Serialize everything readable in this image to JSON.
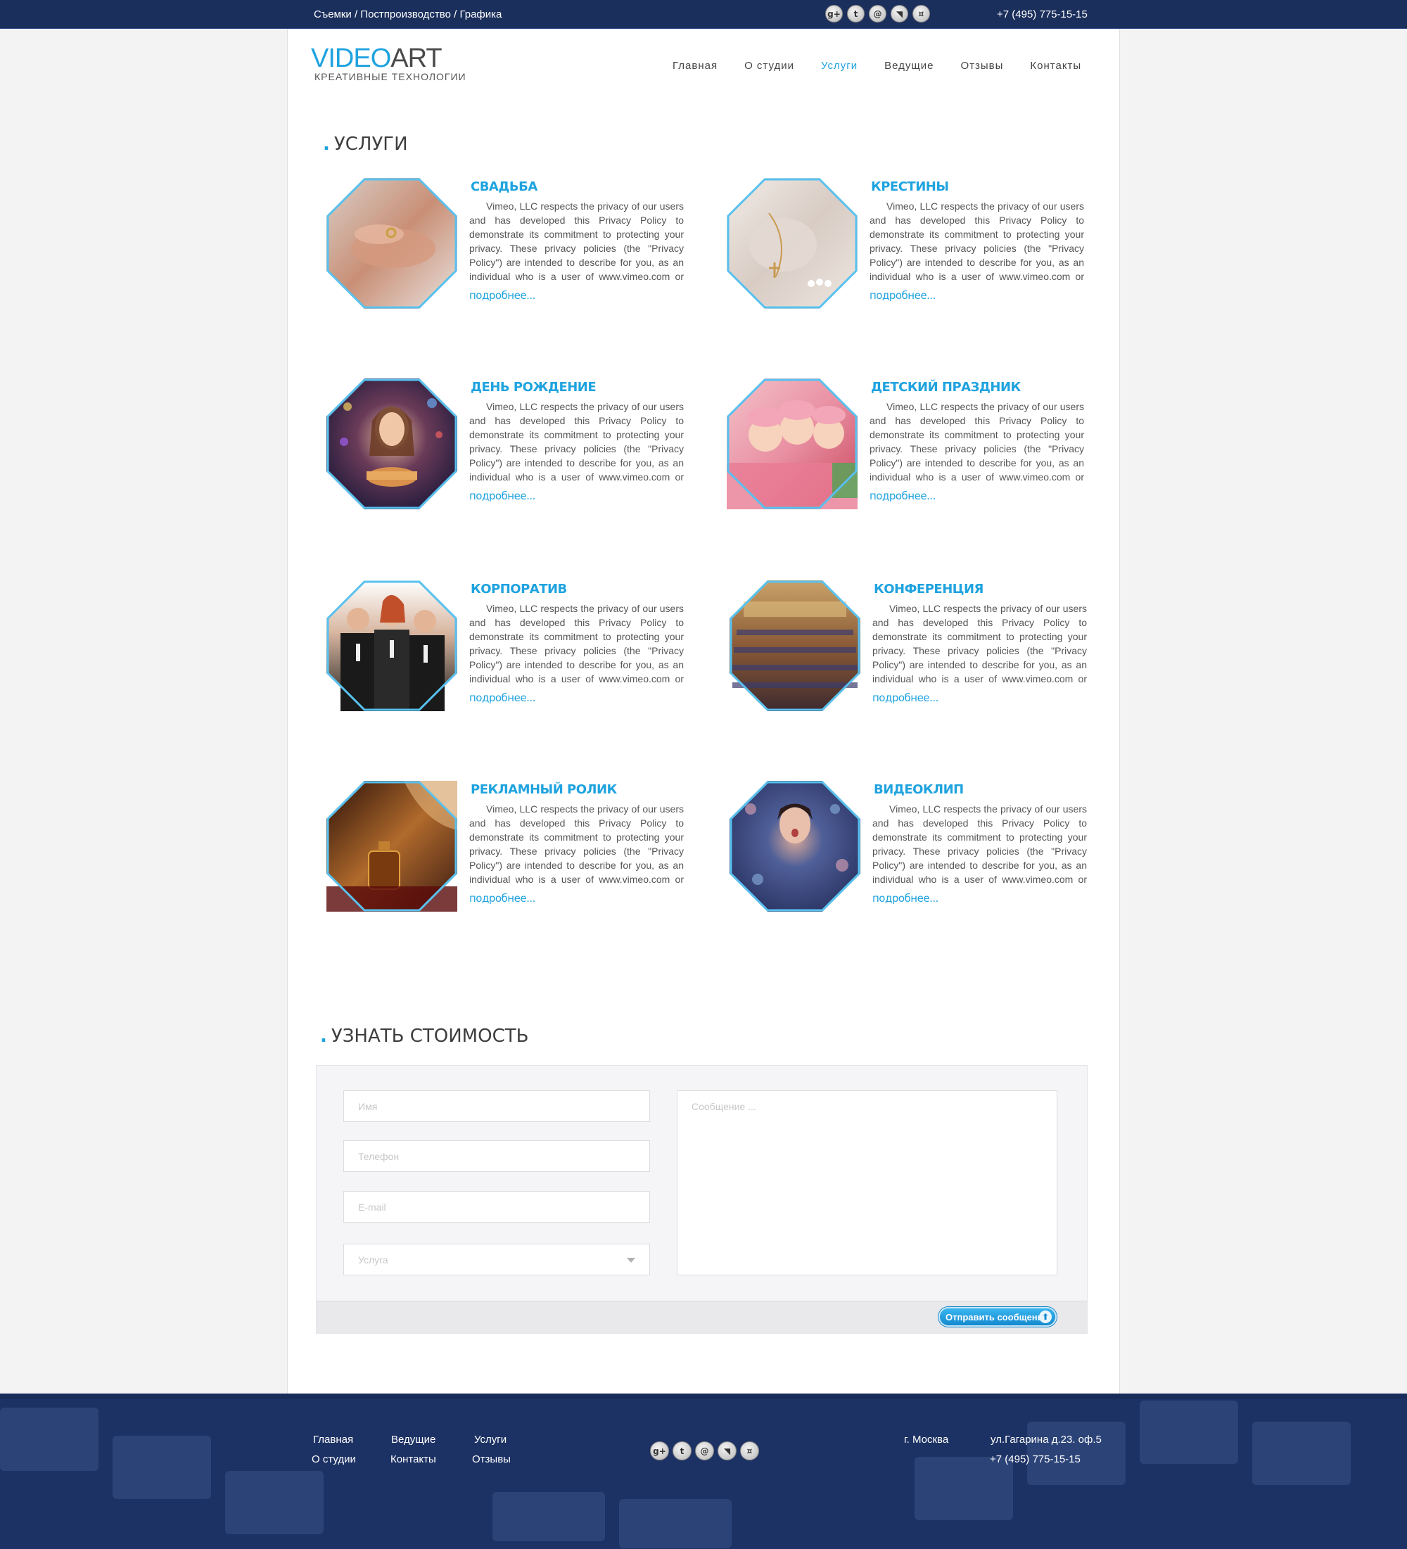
{
  "topbar": {
    "tagline": "Съемки / Постпроизводство / Графика",
    "phone": "+7 (495) 775-15-15",
    "social": [
      {
        "icon": "google-plus-icon",
        "glyph": "g+"
      },
      {
        "icon": "twitter-icon",
        "glyph": "t"
      },
      {
        "icon": "email-icon",
        "glyph": "@"
      },
      {
        "icon": "rss-icon",
        "glyph": "◥"
      },
      {
        "icon": "odnoklassniki-icon",
        "glyph": "¤"
      }
    ]
  },
  "logo": {
    "word1": "VIDEO",
    "word2": "ART",
    "subtitle": "КРЕАТИВНЫЕ ТЕХНОЛОГИИ"
  },
  "nav": {
    "items": [
      "Главная",
      "О студии",
      "Услуги",
      "Ведущие",
      "Отзывы",
      "Контакты"
    ],
    "active": "Услуги"
  },
  "services": {
    "title": "УСЛУГИ",
    "more_label": "подробнее...",
    "description": "Vimeo, LLC respects the privacy of our users and has developed this Privacy Policy to demonstrate its commitment to protecting your privacy. These privacy policies (the \"Privacy Policy\") are intended to describe for you, as an individual who is a user of www.vimeo.com or our",
    "items": [
      {
        "title": "СВАДЬБА"
      },
      {
        "title": "КРЕСТИНЫ"
      },
      {
        "title": "ДЕНЬ РОЖДЕНИЕ"
      },
      {
        "title": "ДЕТСКИЙ ПРАЗДНИК"
      },
      {
        "title": "КОРПОРАТИВ"
      },
      {
        "title": "КОНФЕРЕНЦИЯ"
      },
      {
        "title": "РЕКЛАМНЫЙ РОЛИК"
      },
      {
        "title": "ВИДЕОКЛИП"
      }
    ]
  },
  "pricing": {
    "title": "УЗНАТЬ СТОИМОСТЬ",
    "name_placeholder": "Имя",
    "phone_placeholder": "Телефон",
    "email_placeholder": "E-mail",
    "service_placeholder": "Услуга",
    "message_placeholder": "Сообщение ...",
    "send_label": "Отправить сообщение"
  },
  "footer": {
    "nav": [
      "Главная",
      "Ведущие",
      "Услуги",
      "О студии",
      "Контакты",
      "Отзывы"
    ],
    "city": "г. Москва",
    "address": "ул.Гагарина д.23. оф.5",
    "phone": "+7 (495) 775-15-15"
  },
  "colors": {
    "accent": "#1fa3df",
    "topbar": "#1b2f5c",
    "footer": "#1d3264"
  }
}
